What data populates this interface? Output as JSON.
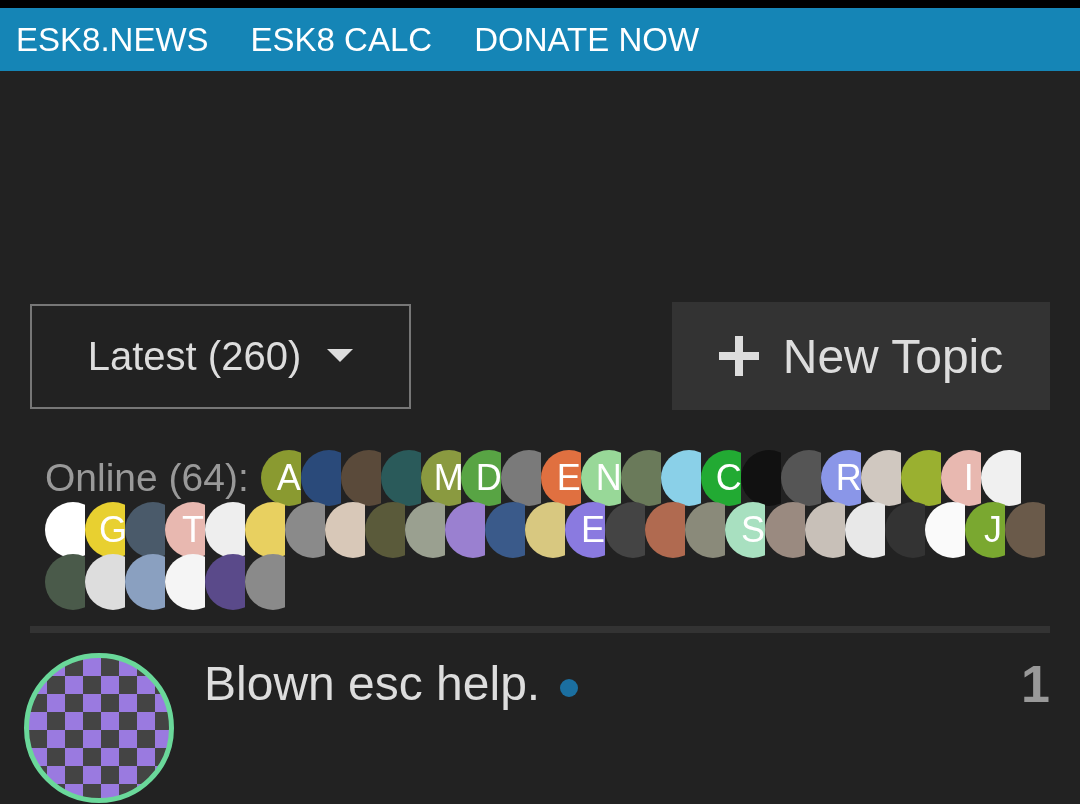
{
  "nav": {
    "links": [
      "ESK8.NEWS",
      "ESK8 CALC",
      "DONATE NOW"
    ]
  },
  "controls": {
    "filter": "Latest (260)",
    "new_topic": "New Topic"
  },
  "online": {
    "label": "Online (64):",
    "users": [
      {
        "kind": "letter",
        "letter": "A",
        "color": "#8a9a30"
      },
      {
        "kind": "image",
        "color": "#2a4a7a"
      },
      {
        "kind": "image",
        "color": "#5a4a3a"
      },
      {
        "kind": "image",
        "color": "#2a5a5a"
      },
      {
        "kind": "letter",
        "letter": "M",
        "color": "#8a9a40"
      },
      {
        "kind": "letter",
        "letter": "D",
        "color": "#58a444"
      },
      {
        "kind": "image",
        "color": "#7a7a7a"
      },
      {
        "kind": "letter",
        "letter": "E",
        "color": "#e07040"
      },
      {
        "kind": "letter",
        "letter": "N",
        "color": "#98d898"
      },
      {
        "kind": "image",
        "color": "#6a7a5a"
      },
      {
        "kind": "image",
        "color": "#8ad0e8"
      },
      {
        "kind": "letter",
        "letter": "C",
        "color": "#22aa33"
      },
      {
        "kind": "image",
        "color": "#111111"
      },
      {
        "kind": "image",
        "color": "#555555"
      },
      {
        "kind": "letter",
        "letter": "R",
        "color": "#8a96e8"
      },
      {
        "kind": "image",
        "color": "#d0c8c0"
      },
      {
        "kind": "image",
        "color": "#9ab030"
      },
      {
        "kind": "letter",
        "letter": "I",
        "color": "#e8b8b0"
      },
      {
        "kind": "image",
        "color": "#f0f0f0"
      },
      {
        "kind": "image",
        "color": "#ffffff"
      },
      {
        "kind": "letter",
        "letter": "G",
        "color": "#e8d030"
      },
      {
        "kind": "image",
        "color": "#4a5a6a"
      },
      {
        "kind": "letter",
        "letter": "T",
        "color": "#e8b8b0"
      },
      {
        "kind": "image",
        "color": "#eeeeee"
      },
      {
        "kind": "image",
        "color": "#e8d060"
      },
      {
        "kind": "image",
        "color": "#8a8a8a"
      },
      {
        "kind": "image",
        "color": "#d8c8b8"
      },
      {
        "kind": "image",
        "color": "#5a5a3a"
      },
      {
        "kind": "image",
        "color": "#9aa090"
      },
      {
        "kind": "image",
        "color": "#9a80d0"
      },
      {
        "kind": "image",
        "color": "#3a5a8a"
      },
      {
        "kind": "image",
        "color": "#d8c880"
      },
      {
        "kind": "letter",
        "letter": "E",
        "color": "#8a7ae0"
      },
      {
        "kind": "image",
        "color": "#444444"
      },
      {
        "kind": "image",
        "color": "#b06a50"
      },
      {
        "kind": "image",
        "color": "#8a8a7a"
      },
      {
        "kind": "letter",
        "letter": "S",
        "color": "#a8e0c0"
      },
      {
        "kind": "image",
        "color": "#9a8a80"
      },
      {
        "kind": "image",
        "color": "#c8c0b8"
      },
      {
        "kind": "image",
        "color": "#e8e8e8"
      },
      {
        "kind": "image",
        "color": "#333333"
      },
      {
        "kind": "image",
        "color": "#fafafa"
      },
      {
        "kind": "letter",
        "letter": "J",
        "color": "#7aa830"
      },
      {
        "kind": "image",
        "color": "#6a5a4a"
      },
      {
        "kind": "image",
        "color": "#4a5a4a"
      },
      {
        "kind": "image",
        "color": "#dddddd"
      },
      {
        "kind": "image",
        "color": "#8aa0c0"
      },
      {
        "kind": "image",
        "color": "#f5f5f5"
      },
      {
        "kind": "image",
        "color": "#5a4a8a"
      },
      {
        "kind": "image",
        "color": "#8a8a8a"
      }
    ]
  },
  "topics": [
    {
      "title": "Blown esc help.",
      "unread": true,
      "replies": "1"
    }
  ]
}
